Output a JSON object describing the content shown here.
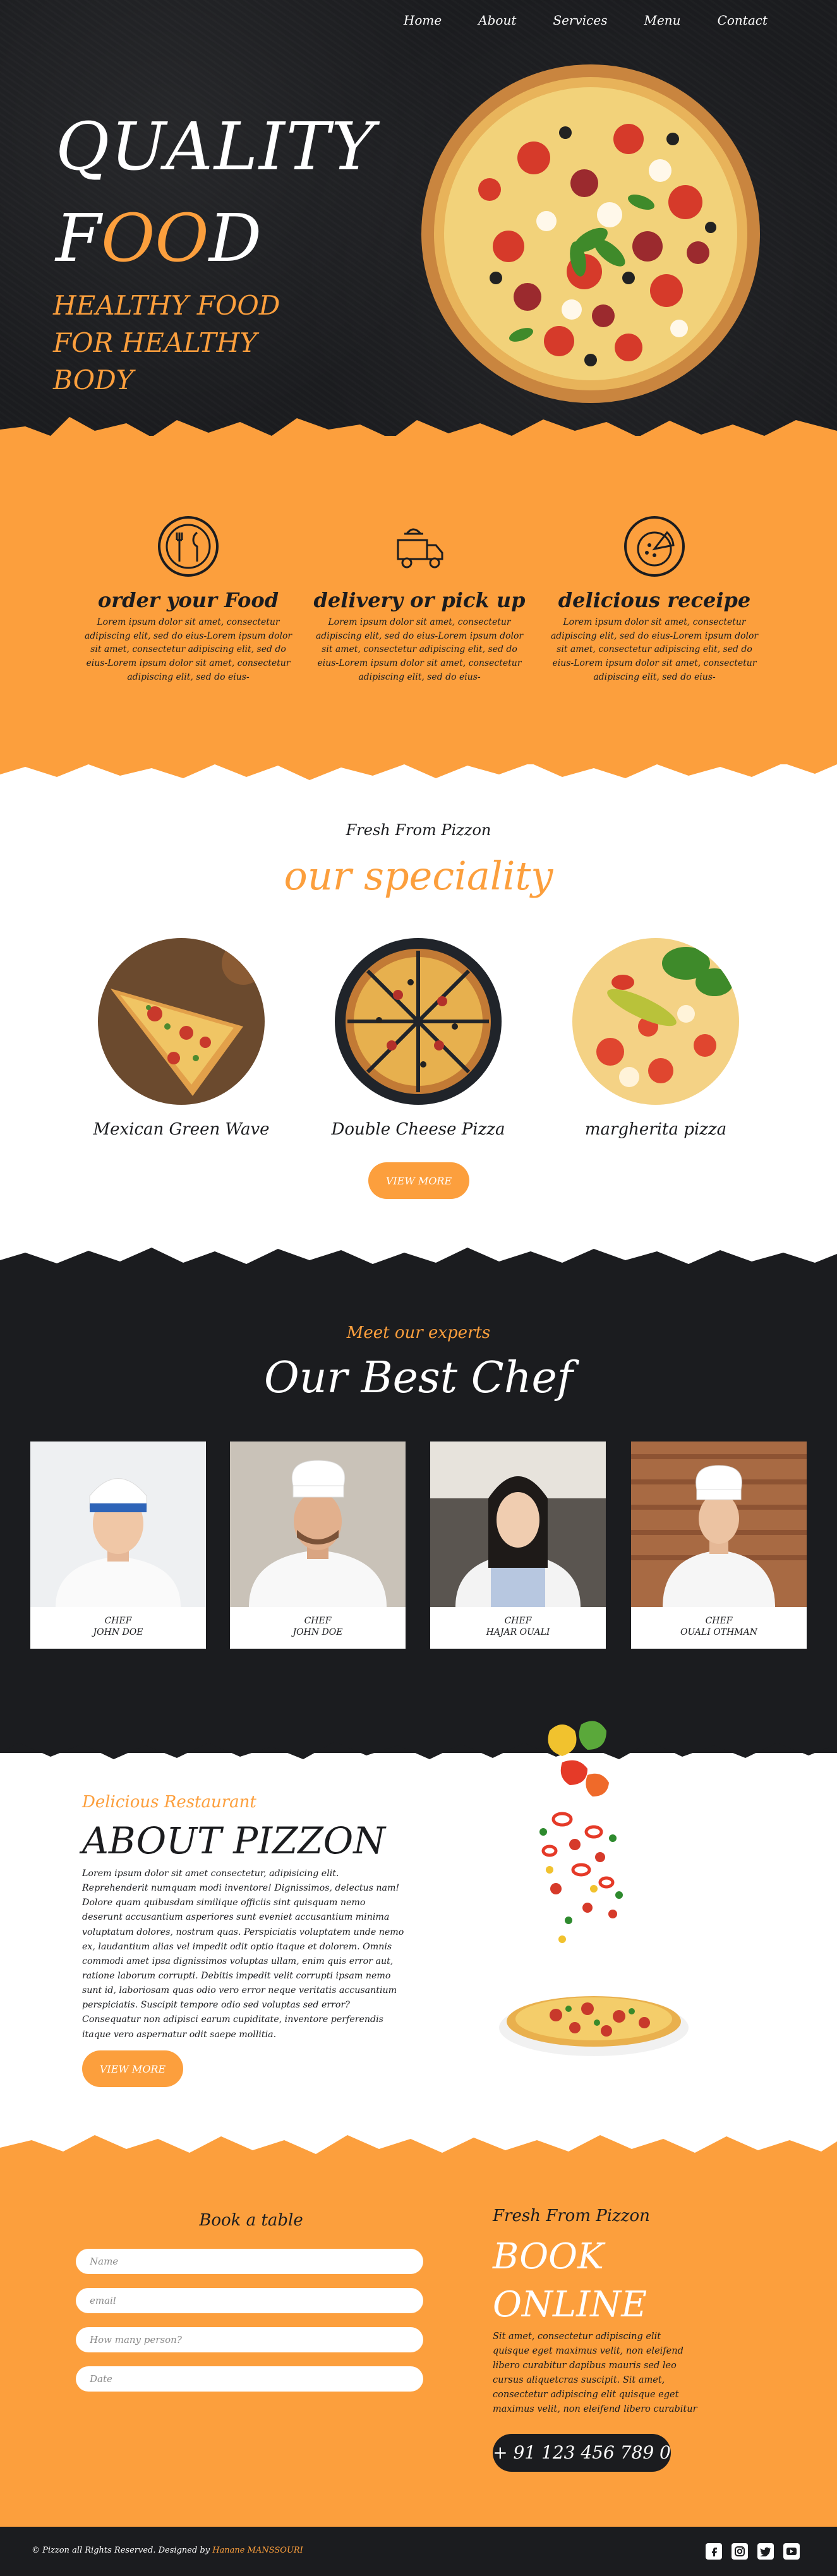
{
  "nav": {
    "items": [
      "Home",
      "About",
      "Services",
      "Menu",
      "Contact"
    ]
  },
  "hero": {
    "title_line1": "QUALITY",
    "title_line2_a": "F",
    "title_line2_b": "OO",
    "title_line2_c": "D",
    "subtitle": "HEALTHY FOOD FOR HEALTHY BODY"
  },
  "features": [
    {
      "icon": "plate-cutlery-icon",
      "title": "order your Food",
      "text": "Lorem ipsum dolor sit amet, consectetur adipiscing elit, sed do eius-Lorem ipsum dolor sit amet, consectetur adipiscing elit, sed do eius-Lorem ipsum dolor sit amet, consectetur adipiscing elit, sed do eius-"
    },
    {
      "icon": "delivery-truck-icon",
      "title": "delivery or pick up",
      "text": "Lorem ipsum dolor sit amet, consectetur adipiscing elit, sed do eius-Lorem ipsum dolor sit amet, consectetur adipiscing elit, sed do eius-Lorem ipsum dolor sit amet, consectetur adipiscing elit, sed do eius-"
    },
    {
      "icon": "pizza-recipe-icon",
      "title": "delicious receipe",
      "text": "Lorem ipsum dolor sit amet, consectetur adipiscing elit, sed do eius-Lorem ipsum dolor sit amet, consectetur adipiscing elit, sed do eius-Lorem ipsum dolor sit amet, consectetur adipiscing elit, sed do eius-"
    }
  ],
  "speciality": {
    "kicker": "Fresh From Pizzon",
    "title": "our speciality",
    "items": [
      "Mexican Green Wave",
      "Double Cheese Pizza",
      "margherita pizza"
    ],
    "button": "VIEW MORE"
  },
  "chefs": {
    "kicker": "Meet our experts",
    "title": "Our Best Chef",
    "items": [
      {
        "role": "CHEF",
        "name": "JOHN DOE"
      },
      {
        "role": "CHEF",
        "name": "JOHN DOE"
      },
      {
        "role": "CHEF",
        "name": "HAJAR OUALI"
      },
      {
        "role": "CHEF",
        "name": "OUALI OTHMAN"
      }
    ]
  },
  "about": {
    "kicker": "Delicious Restaurant",
    "title": "ABOUT PIZZON",
    "text": "Lorem ipsum dolor sit amet consectetur, adipisicing elit. Reprehenderit numquam modi inventore! Dignissimos, delectus nam! Dolore quam quibusdam similique officiis sint quisquam nemo deserunt accusantium asperiores sunt eveniet accusantium minima voluptatum dolores, nostrum quas. Perspiciatis voluptatem unde nemo ex, laudantium alias vel impedit odit optio itaque et dolorem. Omnis commodi amet ipsa dignissimos voluptas ullam, enim quis error aut, ratione laborum corrupti. Debitis impedit velit corrupti ipsam nemo sunt id, laboriosam quas odio vero error neque veritatis accusantium perspiciatis. Suscipit tempore odio sed voluptas sed error? Consequatur non adipisci earum cupiditate, inventore perferendis itaque vero aspernatur odit saepe mollitia.",
    "button": "VIEW MORE"
  },
  "booking": {
    "heading": "Book a table",
    "fields": {
      "name": "Name",
      "email": "email",
      "persons": "How many person?",
      "date": "Date"
    }
  },
  "book_online": {
    "kicker": "Fresh From Pizzon",
    "title_line1": "BOOK",
    "title_line2": "ONLINE",
    "text": "Sit amet, consectetur adipiscing elit quisque eget maximus velit, non eleifend libero curabitur dapibus mauris sed leo cursus aliquetcras suscipit. Sit amet, consectetur adipiscing elit quisque eget maximus velit, non eleifend libero curabitur",
    "phone": "+ 91 123 456 789 0"
  },
  "footer": {
    "copy_prefix": "© Pizzon all Rights Reserved. Designed by",
    "designer": "Hanane MANSSOURI",
    "social": [
      "facebook-icon",
      "instagram-icon",
      "twitter-icon",
      "youtube-icon"
    ]
  },
  "colors": {
    "accent": "#fc9f3d",
    "dark": "#1b1c1f",
    "white": "#ffffff"
  }
}
